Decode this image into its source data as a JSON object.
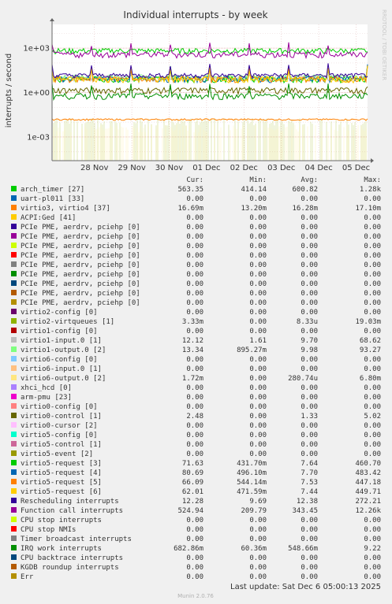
{
  "chart_data": {
    "type": "line",
    "title": "Individual interrupts - by week",
    "ylabel": "interrupts / second",
    "y_scale": "log",
    "y_ticks": [
      "1e-03",
      "1e+00",
      "1e+03"
    ],
    "y_tick_values": [
      0.001,
      1,
      1000
    ],
    "ylim": [
      2.51e-05,
      40000
    ],
    "x_ticks": [
      "28 Nov",
      "29 Nov",
      "30 Nov",
      "01 Dec",
      "02 Dec",
      "03 Dec",
      "04 Dec",
      "05 Dec"
    ],
    "grid": true,
    "side_label": "RRDTOOL / TOBI OETIKER",
    "columns": [
      "Cur:",
      "Min:",
      "Avg:",
      "Max:"
    ],
    "series": [
      {
        "name": "arch_timer [27]",
        "color": "#00cc00",
        "cur": "563.35",
        "min": "414.14",
        "avg": "600.82",
        "max": "1.28k"
      },
      {
        "name": "uart-pl011 [33]",
        "color": "#0066b3",
        "cur": "0.00",
        "min": "0.00",
        "avg": "0.00",
        "max": "0.00"
      },
      {
        "name": "virtio3, virtio4 [37]",
        "color": "#ff8000",
        "cur": "16.69m",
        "min": "13.20m",
        "avg": "16.28m",
        "max": "17.10m"
      },
      {
        "name": "ACPI:Ged [41]",
        "color": "#ffcc00",
        "cur": "0.00",
        "min": "0.00",
        "avg": "0.00",
        "max": "0.00"
      },
      {
        "name": "PCIe PME, aerdrv, pciehp [0]",
        "color": "#330099",
        "cur": "0.00",
        "min": "0.00",
        "avg": "0.00",
        "max": "0.00"
      },
      {
        "name": "PCIe PME, aerdrv, pciehp [0]",
        "color": "#990099",
        "cur": "0.00",
        "min": "0.00",
        "avg": "0.00",
        "max": "0.00"
      },
      {
        "name": "PCIe PME, aerdrv, pciehp [0]",
        "color": "#ccff00",
        "cur": "0.00",
        "min": "0.00",
        "avg": "0.00",
        "max": "0.00"
      },
      {
        "name": "PCIe PME, aerdrv, pciehp [0]",
        "color": "#ff0000",
        "cur": "0.00",
        "min": "0.00",
        "avg": "0.00",
        "max": "0.00"
      },
      {
        "name": "PCIe PME, aerdrv, pciehp [0]",
        "color": "#808080",
        "cur": "0.00",
        "min": "0.00",
        "avg": "0.00",
        "max": "0.00"
      },
      {
        "name": "PCIe PME, aerdrv, pciehp [0]",
        "color": "#008f00",
        "cur": "0.00",
        "min": "0.00",
        "avg": "0.00",
        "max": "0.00"
      },
      {
        "name": "PCIe PME, aerdrv, pciehp [0]",
        "color": "#00487d",
        "cur": "0.00",
        "min": "0.00",
        "avg": "0.00",
        "max": "0.00"
      },
      {
        "name": "PCIe PME, aerdrv, pciehp [0]",
        "color": "#b35a00",
        "cur": "0.00",
        "min": "0.00",
        "avg": "0.00",
        "max": "0.00"
      },
      {
        "name": "PCIe PME, aerdrv, pciehp [0]",
        "color": "#b38f00",
        "cur": "0.00",
        "min": "0.00",
        "avg": "0.00",
        "max": "0.00"
      },
      {
        "name": "virtio2-config [0]",
        "color": "#6b006b",
        "cur": "0.00",
        "min": "0.00",
        "avg": "0.00",
        "max": "0.00"
      },
      {
        "name": "virtio2-virtqueues [1]",
        "color": "#8fb300",
        "cur": "3.33m",
        "min": "0.00",
        "avg": "8.33u",
        "max": "19.03m"
      },
      {
        "name": "virtio1-config [0]",
        "color": "#b30000",
        "cur": "0.00",
        "min": "0.00",
        "avg": "0.00",
        "max": "0.00"
      },
      {
        "name": "virtio1-input.0 [1]",
        "color": "#bebebe",
        "cur": "12.12",
        "min": "1.61",
        "avg": "9.70",
        "max": "68.62"
      },
      {
        "name": "virtio1-output.0 [2]",
        "color": "#80ff80",
        "cur": "13.34",
        "min": "895.27m",
        "avg": "9.98",
        "max": "93.27"
      },
      {
        "name": "virtio6-config [0]",
        "color": "#80c9ff",
        "cur": "0.00",
        "min": "0.00",
        "avg": "0.00",
        "max": "0.00"
      },
      {
        "name": "virtio6-input.0 [1]",
        "color": "#ffc080",
        "cur": "0.00",
        "min": "0.00",
        "avg": "0.00",
        "max": "0.00"
      },
      {
        "name": "virtio6-output.0 [2]",
        "color": "#ffe680",
        "cur": "1.72m",
        "min": "0.00",
        "avg": "280.74u",
        "max": "6.80m"
      },
      {
        "name": "xhci_hcd [0]",
        "color": "#aa80ff",
        "cur": "0.00",
        "min": "0.00",
        "avg": "0.00",
        "max": "0.00"
      },
      {
        "name": "arm-pmu [23]",
        "color": "#ee00cc",
        "cur": "0.00",
        "min": "0.00",
        "avg": "0.00",
        "max": "0.00"
      },
      {
        "name": "virtio0-config [0]",
        "color": "#ff8080",
        "cur": "0.00",
        "min": "0.00",
        "avg": "0.00",
        "max": "0.00"
      },
      {
        "name": "virtio0-control [1]",
        "color": "#666600",
        "cur": "2.48",
        "min": "0.00",
        "avg": "1.33",
        "max": "5.02"
      },
      {
        "name": "virtio0-cursor [2]",
        "color": "#ffbfff",
        "cur": "0.00",
        "min": "0.00",
        "avg": "0.00",
        "max": "0.00"
      },
      {
        "name": "virtio5-config [0]",
        "color": "#00ffcc",
        "cur": "0.00",
        "min": "0.00",
        "avg": "0.00",
        "max": "0.00"
      },
      {
        "name": "virtio5-control [1]",
        "color": "#cc6699",
        "cur": "0.00",
        "min": "0.00",
        "avg": "0.00",
        "max": "0.00"
      },
      {
        "name": "virtio5-event [2]",
        "color": "#999900",
        "cur": "0.00",
        "min": "0.00",
        "avg": "0.00",
        "max": "0.00"
      },
      {
        "name": "virtio5-request [3]",
        "color": "#00cc00",
        "cur": "71.63",
        "min": "431.70m",
        "avg": "7.64",
        "max": "460.70"
      },
      {
        "name": "virtio5-request [4]",
        "color": "#0066b3",
        "cur": "80.69",
        "min": "496.10m",
        "avg": "7.70",
        "max": "483.42"
      },
      {
        "name": "virtio5-request [5]",
        "color": "#ff8000",
        "cur": "66.09",
        "min": "544.14m",
        "avg": "7.53",
        "max": "447.18"
      },
      {
        "name": "virtio5-request [6]",
        "color": "#ffcc00",
        "cur": "62.01",
        "min": "471.59m",
        "avg": "7.44",
        "max": "449.71"
      },
      {
        "name": "Rescheduling interrupts",
        "color": "#330099",
        "cur": "12.28",
        "min": "9.69",
        "avg": "12.38",
        "max": "272.21"
      },
      {
        "name": "Function call interrupts",
        "color": "#990099",
        "cur": "524.94",
        "min": "209.79",
        "avg": "343.45",
        "max": "12.26k"
      },
      {
        "name": "CPU stop interrupts",
        "color": "#ccff00",
        "cur": "0.00",
        "min": "0.00",
        "avg": "0.00",
        "max": "0.00"
      },
      {
        "name": "CPU stop NMIs",
        "color": "#ff0000",
        "cur": "0.00",
        "min": "0.00",
        "avg": "0.00",
        "max": "0.00"
      },
      {
        "name": "Timer broadcast interrupts",
        "color": "#808080",
        "cur": "0.00",
        "min": "0.00",
        "avg": "0.00",
        "max": "0.00"
      },
      {
        "name": "IRQ work interrupts",
        "color": "#008f00",
        "cur": "682.86m",
        "min": "60.36m",
        "avg": "548.66m",
        "max": "9.22"
      },
      {
        "name": "CPU backtrace interrupts",
        "color": "#00487d",
        "cur": "0.00",
        "min": "0.00",
        "avg": "0.00",
        "max": "0.00"
      },
      {
        "name": "KGDB roundup interrupts",
        "color": "#b35a00",
        "cur": "0.00",
        "min": "0.00",
        "avg": "0.00",
        "max": "0.00"
      },
      {
        "name": "Err",
        "color": "#b38f00",
        "cur": "0.00",
        "min": "0.00",
        "avg": "0.00",
        "max": "0.00"
      }
    ],
    "last_update": "Last update:  Sat Dec  6 05:00:13 2025",
    "footer": "Munin 2.0.76"
  }
}
